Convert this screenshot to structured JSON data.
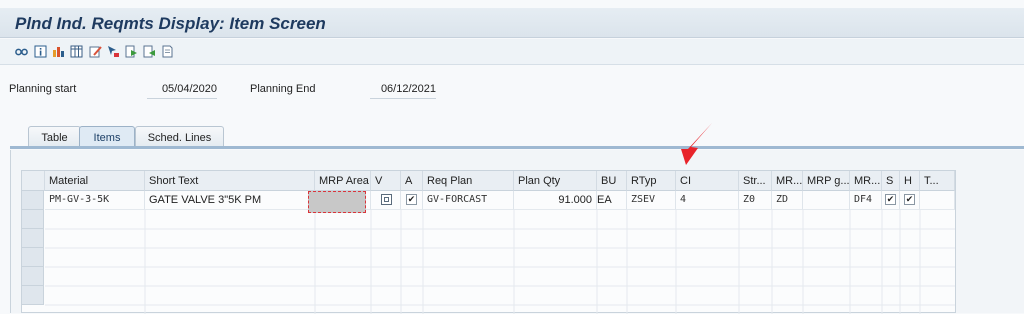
{
  "window": {
    "title": "Plnd Ind. Reqmts Display: Item Screen"
  },
  "toolbar": {
    "icons": [
      "glasses-icon",
      "info-icon",
      "columns-settings-icon",
      "table-icon",
      "edit-icon",
      "search-pointer-icon",
      "export-icon",
      "import-icon",
      "document-icon"
    ]
  },
  "header": {
    "planning_start_label": "Planning start",
    "planning_start_value": "05/04/2020",
    "planning_end_label": "Planning End",
    "planning_end_value": "06/12/2021"
  },
  "tabs": [
    {
      "label": "Table",
      "active": false
    },
    {
      "label": "Items",
      "active": true
    },
    {
      "label": "Sched. Lines",
      "active": false
    }
  ],
  "grid": {
    "columns": [
      "Material",
      "Short Text",
      "MRP Area",
      "V",
      "A",
      "Req Plan",
      "Plan Qty",
      "BU",
      "RTyp",
      "CI",
      "Str...",
      "MR...",
      "MRP g...",
      "MR...",
      "S",
      "H",
      "T..."
    ],
    "row": {
      "material": "PM-GV-3-5K",
      "short_text": "GATE VALVE 3\"5K PM",
      "req_plan": "GV-FORCAST",
      "plan_qty": "91.000",
      "bu": "EA",
      "rtyp": "ZSEV",
      "ci": "4",
      "str": "Z0",
      "mr1": "ZD",
      "mr2": "DF4"
    }
  },
  "colors": {
    "accent": "#9fb9d2",
    "title": "#1e3a5f",
    "annotation_arrow": "#e8232a"
  }
}
